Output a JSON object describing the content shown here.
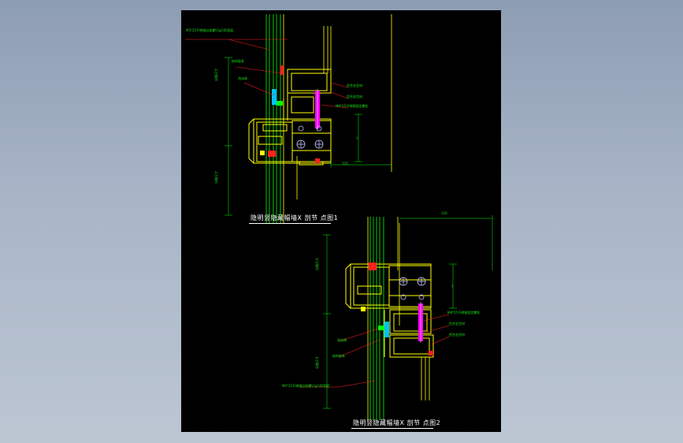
{
  "drawing": {
    "detail1": {
      "title": "隐明竖隐藏幅墙X 剖节 点图1",
      "dimension_width": "120",
      "dimension_height": "Y",
      "labels": {
        "top_note": "M5*25不锈钢自攻螺钉@500固定",
        "sealant_top": "结构胶条",
        "backing": "泡沫棒",
        "aluminum_1": "铝合金型材",
        "aluminum_2": "铝合金型材",
        "bolt": "M8*25不锈钢固定螺栓",
        "vert_upper": "分格尺寸",
        "vert_lower": "分格尺寸"
      }
    },
    "detail2": {
      "title": "隐明竖隐藏幅墙X 剖节 点图2",
      "dimension_width": "120",
      "dimension_height": "Y",
      "labels": {
        "bolt": "M8*25不锈钢固定螺栓",
        "aluminum_1": "铝合金型材",
        "aluminum_2": "铝合金型材",
        "backing": "泡沫棒",
        "sealant": "结构胶条",
        "bottom_note": "M5*25不锈钢自攻螺钉@500固定",
        "vert_upper": "分格尺寸",
        "vert_lower": "分格尺寸"
      }
    }
  },
  "colors": {
    "background": "#000000",
    "profile": "#ffff00",
    "glass": "#00ff00",
    "leader": "#ff2020",
    "dimension": "#00ff00",
    "bolt": "#ff00ff",
    "seal": "#00c0ff",
    "text_title": "#ffffff"
  }
}
